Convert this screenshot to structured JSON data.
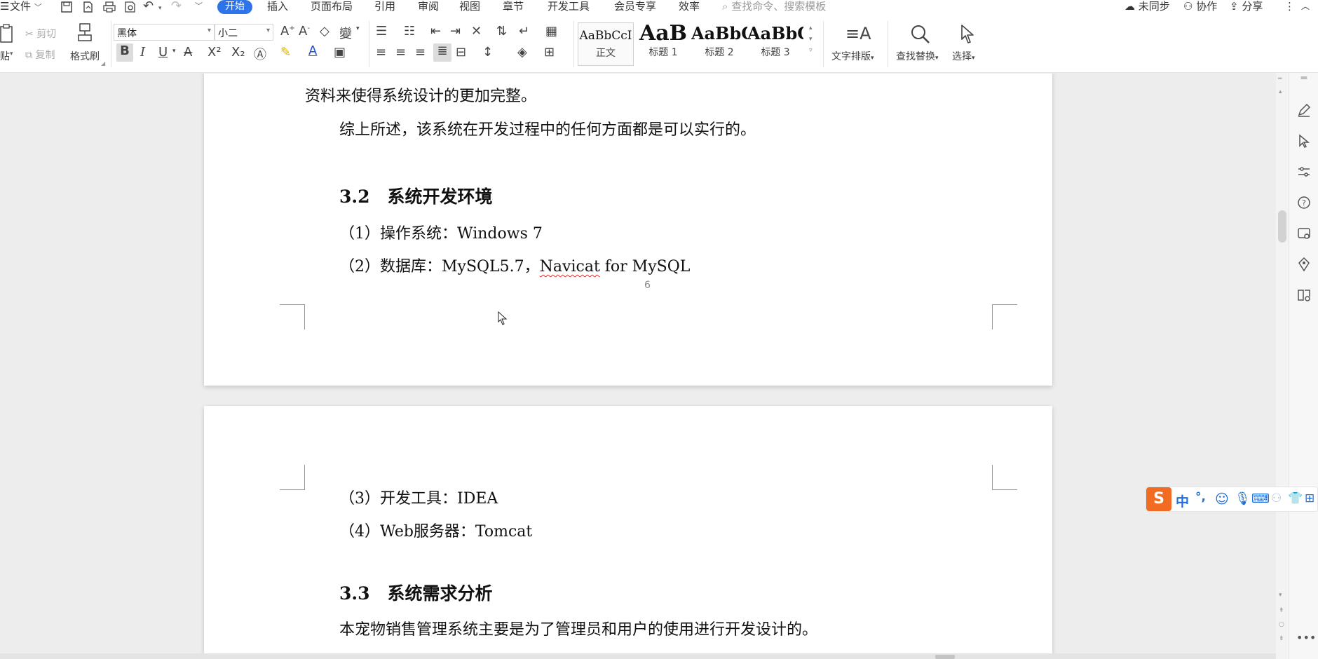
{
  "menubar": {
    "file_label": "文件",
    "tabs": [
      {
        "label": "开始",
        "active": true
      },
      {
        "label": "插入"
      },
      {
        "label": "页面布局"
      },
      {
        "label": "引用"
      },
      {
        "label": "审阅"
      },
      {
        "label": "视图"
      },
      {
        "label": "章节"
      },
      {
        "label": "开发工具"
      },
      {
        "label": "会员专享"
      },
      {
        "label": "效率"
      }
    ],
    "search_placeholder": "查找命令、搜索模板",
    "sync_label": "未同步",
    "collab_label": "协作",
    "share_label": "分享"
  },
  "ribbon": {
    "cut_label": "剪切",
    "paste_label": "贴",
    "copy_label": "复制",
    "format_painter_label": "格式刷",
    "font_name": "黑体",
    "font_size": "小二",
    "styles": [
      {
        "sample": "AaBbCcI",
        "label": "正文"
      },
      {
        "sample": "AaB",
        "label": "标题 1"
      },
      {
        "sample": "AaBbC",
        "label": "标题 2"
      },
      {
        "sample": "AaBbC",
        "label": "标题 3"
      }
    ],
    "text_layout_label": "文字排版",
    "find_replace_label": "查找替换",
    "select_label": "选择"
  },
  "document": {
    "page1": {
      "line_continued": "资料来使得系统设计的更加完整。",
      "line_summary": "综上所述，该系统在开发过程中的任何方面都是可以实行的。",
      "heading_3_2": "3.2　系统开发环境",
      "item1": "（1）操作系统：Windows 7",
      "item2_prefix": "（2）数据库：MySQL5.7，",
      "item2_misspelled": "Navicat",
      "item2_suffix": " for MySQL",
      "page_number": "6"
    },
    "page2": {
      "item3": "（3）开发工具：IDEA",
      "item4": "（4）Web服务器：Tomcat",
      "heading_3_3": "3.3　系统需求分析",
      "para": "本宠物销售管理系统主要是为了管理员和用户的使用进行开发设计的。"
    }
  },
  "ime": {
    "lang": "中",
    "punct": "°,"
  },
  "colors": {
    "accent": "#2e74e8",
    "ime_logo": "#f26b22",
    "ime_icons": "#1e6fd9",
    "spell_underline": "#e03030"
  }
}
